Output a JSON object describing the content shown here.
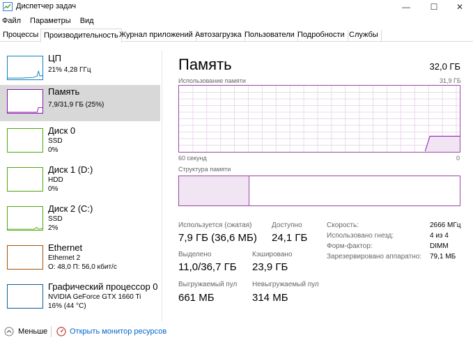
{
  "window": {
    "title": "Диспетчер задач",
    "minimize": "—",
    "maximize": "☐",
    "close": "✕"
  },
  "menu": [
    "Файл",
    "Параметры",
    "Вид"
  ],
  "tabs": [
    "Процессы",
    "Производительность",
    "Журнал приложений",
    "Автозагрузка",
    "Пользователи",
    "Подробности",
    "Службы"
  ],
  "colors": {
    "cpu": "#117dbb",
    "memory": "#8b12ae",
    "disk": "#4da60c",
    "ethernet": "#a74f01",
    "gpu": "#0e5c92"
  },
  "sidebar": [
    {
      "name": "ЦП",
      "sub1": "21% 4,28 ГГц",
      "sub2": "",
      "sub3": ""
    },
    {
      "name": "Память",
      "sub1": "7,9/31,9 ГБ (25%)",
      "sub2": "",
      "sub3": ""
    },
    {
      "name": "Диск 0",
      "sub1": "SSD",
      "sub2": "0%",
      "sub3": ""
    },
    {
      "name": "Диск 1 (D:)",
      "sub1": "HDD",
      "sub2": "0%",
      "sub3": ""
    },
    {
      "name": "Диск 2 (C:)",
      "sub1": "SSD",
      "sub2": "2%",
      "sub3": ""
    },
    {
      "name": "Ethernet",
      "sub1": "Ethernet 2",
      "sub2": "О: 48,0 П: 56,0 кбит/с",
      "sub3": ""
    },
    {
      "name": "Графический процессор 0",
      "sub1": "NVIDIA GeForce GTX 1660 Ti",
      "sub2": "16% (44 °C)",
      "sub3": ""
    }
  ],
  "main": {
    "title": "Память",
    "total": "32,0 ГБ",
    "usage_label": "Использование памяти",
    "usage_max": "31,9 ГБ",
    "time_left": "60 секунд",
    "time_right": "0",
    "structure_label": "Структура памяти",
    "used_fraction": 0.25,
    "stats": {
      "in_use_label": "Используется (сжатая)",
      "in_use_value": "7,9 ГБ (36,6 МБ)",
      "available_label": "Доступно",
      "available_value": "24,1 ГБ",
      "committed_label": "Выделено",
      "committed_value": "11,0/36,7 ГБ",
      "cached_label": "Кэшировано",
      "cached_value": "23,9 ГБ",
      "paged_label": "Выгружаемый пул",
      "paged_value": "661 МБ",
      "nonpaged_label": "Невыгружаемый пул",
      "nonpaged_value": "314 МБ"
    },
    "specs": [
      {
        "label": "Скорость:",
        "value": "2666 МГц"
      },
      {
        "label": "Использовано гнезд:",
        "value": "4 из 4"
      },
      {
        "label": "Форм-фактор:",
        "value": "DIMM"
      },
      {
        "label": "Зарезервировано аппаратно:",
        "value": "79,1 МБ"
      }
    ]
  },
  "footer": {
    "less": "Меньше",
    "resmon": "Открыть монитор ресурсов"
  }
}
